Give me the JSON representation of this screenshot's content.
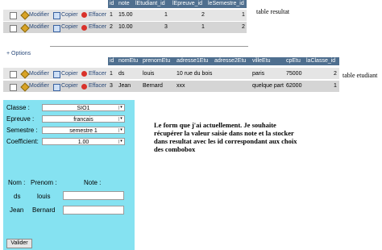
{
  "table1": {
    "columns": [
      "id",
      "note",
      "lEtudiant_id",
      "lEpreuve_id",
      "leSemestre_id"
    ],
    "rows": [
      {
        "action_edit": "Modifier",
        "action_copy": "Copier",
        "action_delete": "Effacer",
        "id": "1",
        "note": "15.00",
        "etudiant": "1",
        "epreuve": "2",
        "semestre": "1"
      },
      {
        "action_edit": "Modifier",
        "action_copy": "Copier",
        "action_delete": "Effacer",
        "id": "2",
        "note": "10.00",
        "etudiant": "3",
        "epreuve": "1",
        "semestre": "2"
      }
    ],
    "caption": "table resultat"
  },
  "table2": {
    "options_label": "+ Options",
    "columns": [
      "id",
      "nomEtu",
      "prenomEtu",
      "adresse1Etu",
      "adresse2Etu",
      "villeEtu",
      "cpEtu",
      "laClasse_id"
    ],
    "rows": [
      {
        "action_edit": "Modifier",
        "action_copy": "Copier",
        "action_delete": "Effacer",
        "id": "1",
        "nom": "ds",
        "prenom": "louis",
        "adresse1": "10 rue du bois",
        "adresse2": "",
        "ville": "paris",
        "cp": "75000",
        "classe": "2"
      },
      {
        "action_edit": "Modifier",
        "action_copy": "Copier",
        "action_delete": "Effacer",
        "id": "3",
        "nom": "Jean",
        "prenom": "Bernard",
        "adresse1": "xxx",
        "adresse2": "",
        "ville": "quelque part",
        "cp": "62000",
        "classe": "1"
      }
    ],
    "caption": "table etudiant"
  },
  "form": {
    "classe_label": "Classe :",
    "classe_value": "SIO1",
    "epreuve_label": "Epreuve :",
    "epreuve_value": "francais",
    "semestre_label": "Semestre :",
    "semestre_value": "semestre 1",
    "coef_label": "Coefficient:",
    "coef_value": "1.00",
    "nom_header": "Nom :",
    "prenom_header": "Prenom :",
    "note_header": "Note :",
    "students": [
      {
        "nom": "ds",
        "prenom": "louis"
      },
      {
        "nom": "Jean",
        "prenom": "Bernard"
      }
    ],
    "submit_label": "Valider"
  },
  "message": "Le form que j'ai actuellement.  Je souhaite récupérer la valeur saisie dans note et la stocker dans resultat avec les id correspondant aux choix des combobox",
  "colors": {
    "header": "#4f6f8f",
    "form_bg": "#85e2f1",
    "row_light": "#e5e5e5",
    "row_dark": "#d5d5d5"
  }
}
